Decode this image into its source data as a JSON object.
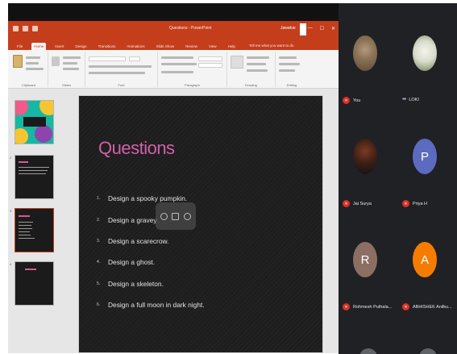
{
  "powerpoint": {
    "title": "Questions - PowerPoint",
    "user": "Jawahar",
    "window_buttons": [
      "—",
      "☐",
      "✕"
    ],
    "tabs": [
      "File",
      "Home",
      "Insert",
      "Design",
      "Transitions",
      "Animations",
      "Slide Show",
      "Review",
      "View",
      "Help"
    ],
    "active_tab": "Home",
    "tell_me": "Tell me what you want to do",
    "ribbon_groups": [
      "Clipboard",
      "Slides",
      "Font",
      "Paragraph",
      "Drawing",
      "Editing"
    ],
    "thumbnail_numbers": [
      "1",
      "2",
      "3",
      "4"
    ]
  },
  "slide": {
    "title": "Questions",
    "items": [
      {
        "num": "1.",
        "text": "Design a spooky pumpkin."
      },
      {
        "num": "2.",
        "text": "Design a gravey"
      },
      {
        "num": "3.",
        "text": "Design a scarecrow."
      },
      {
        "num": "4.",
        "text": "Design a ghost."
      },
      {
        "num": "5.",
        "text": "Design a skeleton."
      },
      {
        "num": "6.",
        "text": "Design a full moon in dark night."
      }
    ]
  },
  "participants": [
    {
      "name": "You",
      "muted": true,
      "picture": "photo"
    },
    {
      "name": "LOKI",
      "muted": false,
      "picture": "photo"
    },
    {
      "name": "Jai Surya",
      "muted": true,
      "picture": "photo"
    },
    {
      "name": "Priya H",
      "muted": true,
      "initial": "P",
      "color": "#5c6bc0"
    },
    {
      "name": "Rohmesh Puthala...",
      "muted": true,
      "initial": "R",
      "color": "#8d6e63"
    },
    {
      "name": "ABHISHEK Anilku...",
      "muted": true,
      "initial": "A",
      "color": "#f57c00"
    }
  ],
  "colors": {
    "powerpoint_accent": "#c43e1c",
    "slide_title": "#d161a8",
    "panel_bg": "#202124",
    "muted_mic": "#d93025"
  }
}
